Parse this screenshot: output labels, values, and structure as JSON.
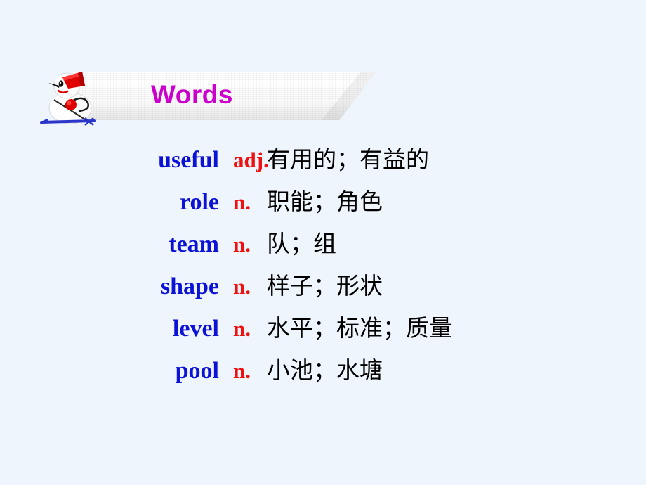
{
  "slide": {
    "background_color": "#eff5fd",
    "banner": {
      "title": "Words",
      "title_color": "#cc00cc",
      "decoration_icon": "skiing-snowman-icon"
    },
    "vocabulary": {
      "word_color": "#0c11d6",
      "pos_color": "#ee1111",
      "meaning_color": "#000000",
      "entries": [
        {
          "word": "useful",
          "pos": "adj.",
          "meaning": "有用的；有益的"
        },
        {
          "word": "role",
          "pos": "n.",
          "meaning": "职能；角色"
        },
        {
          "word": "team",
          "pos": "n.",
          "meaning": "队；组"
        },
        {
          "word": "shape",
          "pos": "n.",
          "meaning": "样子；形状"
        },
        {
          "word": "level",
          "pos": "n.",
          "meaning": "水平；标准；质量"
        },
        {
          "word": "pool",
          "pos": "n.",
          "meaning": "小池；水塘"
        }
      ]
    }
  }
}
